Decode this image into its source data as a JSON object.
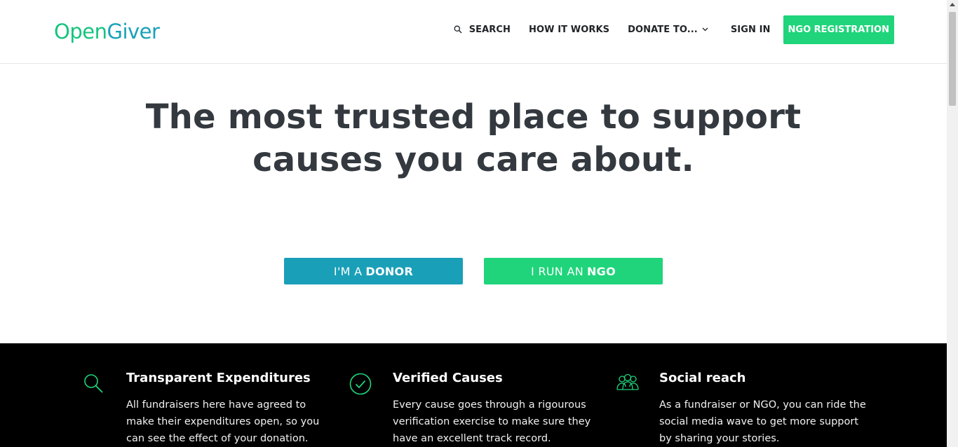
{
  "header": {
    "logo_prefix": "Open",
    "logo_suffix": "Giver",
    "nav": {
      "search_label": "SEARCH",
      "how_label": "HOW IT WORKS",
      "donate_label": "DONATE TO...",
      "signin_label": "SIGN IN",
      "register_label": "NGO REGISTRATION"
    }
  },
  "hero": {
    "title_line1": "The most trusted place to support",
    "title_line2": "causes you care about.",
    "donor_btn_prefix": "I'M A",
    "donor_btn_strong": "DONOR",
    "ngo_btn_prefix": "I RUN AN",
    "ngo_btn_strong": "NGO"
  },
  "features": [
    {
      "icon": "search-icon",
      "title": "Transparent Expenditures",
      "text": "All fundraisers here have agreed to make their expenditures open, so you can see the effect of your donation."
    },
    {
      "icon": "check-circle-icon",
      "title": "Verified Causes",
      "text": "Every cause goes through a rigourous verification exercise to make sure they have an excellent track record."
    },
    {
      "icon": "group-icon",
      "title": "Social reach",
      "text": "As a fundraiser or NGO, you can ride the social media wave to get more support by sharing your stories."
    }
  ],
  "colors": {
    "green": "#1fd47a",
    "teal": "#1a9fb8",
    "dark_text": "#33393f",
    "feature_bg": "#000000"
  }
}
